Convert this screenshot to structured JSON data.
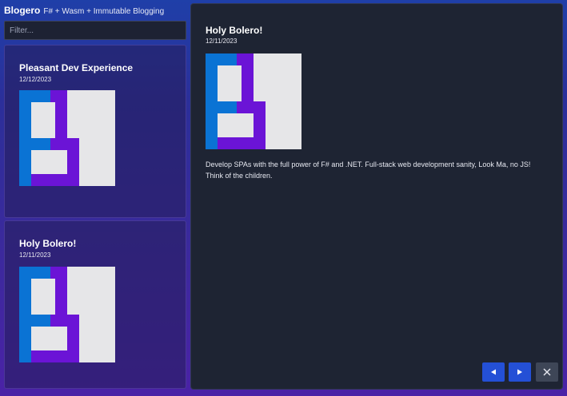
{
  "header": {
    "brand": "Blogero",
    "tagline": "F# + Wasm + Immutable Blogging"
  },
  "filter": {
    "placeholder": "Filter...",
    "value": ""
  },
  "posts": [
    {
      "title": "Pleasant Dev Experience",
      "date": "12/12/2023",
      "image_icon": "blogero-logo-icon"
    },
    {
      "title": "Holy Bolero!",
      "date": "12/11/2023",
      "image_icon": "blogero-logo-icon"
    }
  ],
  "detail": {
    "title": "Holy Bolero!",
    "date": "12/11/2023",
    "image_icon": "blogero-logo-icon",
    "body": "Develop SPAs with the full power of F# and .NET. Full-stack web development sanity, Look Ma, no JS! Think of the children."
  },
  "controls": {
    "prev_icon": "previous-arrow-icon",
    "next_icon": "next-arrow-icon",
    "close_icon": "close-icon"
  },
  "colors": {
    "logo_blue": "#0a73d4",
    "logo_purple": "#6b14d6",
    "logo_light": "#e6e6e8",
    "panel_bg": "#1e2433",
    "button_blue": "#2450d6",
    "button_gray": "#3e4657"
  }
}
